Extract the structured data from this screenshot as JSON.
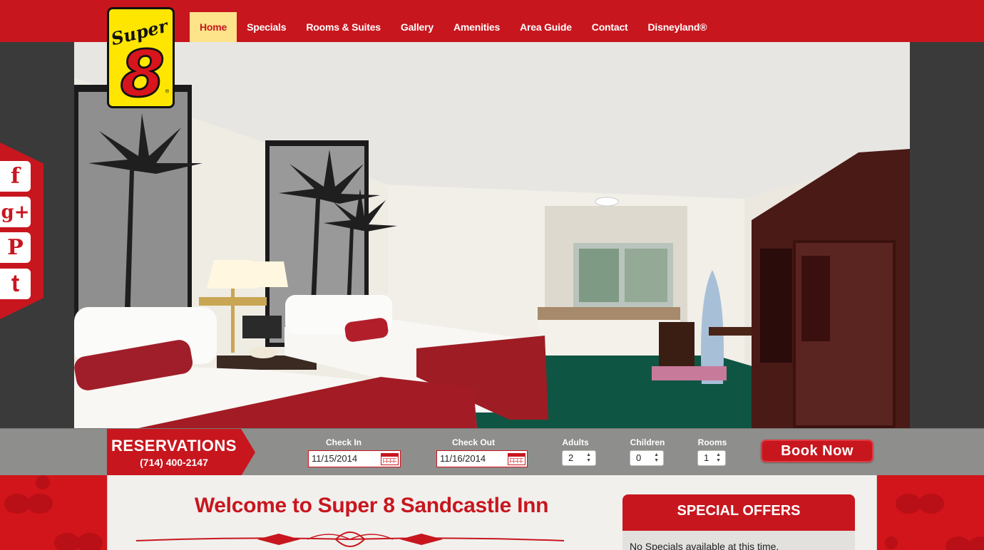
{
  "nav": {
    "items": [
      "Home",
      "Specials",
      "Rooms & Suites",
      "Gallery",
      "Amenities",
      "Area Guide",
      "Contact",
      "Disneyland®"
    ],
    "active_index": 0
  },
  "logo": {
    "text_top": "Super",
    "text_main": "8"
  },
  "social": [
    "facebook",
    "google-plus",
    "pinterest",
    "twitter"
  ],
  "social_glyphs": {
    "facebook": "f",
    "google-plus": "g+",
    "pinterest": "P",
    "twitter": "t"
  },
  "reservations": {
    "title": "RESERVATIONS",
    "phone": "(714) 400-2147",
    "check_in_label": "Check In",
    "check_in_value": "11/15/2014",
    "check_out_label": "Check Out",
    "check_out_value": "11/16/2014",
    "adults_label": "Adults",
    "adults_value": "2",
    "children_label": "Children",
    "children_value": "0",
    "rooms_label": "Rooms",
    "rooms_value": "1",
    "book_label": "Book Now"
  },
  "main": {
    "welcome_title": "Welcome to Super 8 Sandcastle Inn"
  },
  "offers": {
    "title": "SPECIAL OFFERS",
    "message": "No Specials available at this time."
  },
  "colors": {
    "brand_red": "#c8161e",
    "nav_active_bg": "#fde38a",
    "logo_yellow": "#ffe600"
  }
}
